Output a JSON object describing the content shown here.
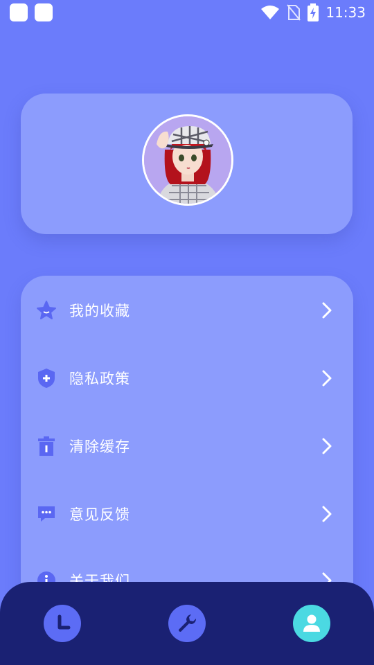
{
  "status_bar": {
    "time": "11:33",
    "icons": [
      "app-square-icon",
      "app-square-icon",
      "wifi-icon",
      "no-sim-icon",
      "battery-charging-icon"
    ]
  },
  "profile": {
    "avatar": "avatar-image"
  },
  "menu": {
    "items": [
      {
        "label": "我的收藏",
        "icon": "star-icon"
      },
      {
        "label": "隐私政策",
        "icon": "shield-icon"
      },
      {
        "label": "清除缓存",
        "icon": "trash-icon"
      },
      {
        "label": "意见反馈",
        "icon": "chat-bubble-icon"
      },
      {
        "label": "关于我们",
        "icon": "info-icon"
      }
    ]
  },
  "bottom_nav": {
    "tabs": [
      {
        "icon": "clock-icon",
        "active": false
      },
      {
        "icon": "wrench-icon",
        "active": false
      },
      {
        "icon": "user-icon",
        "active": true
      }
    ]
  },
  "colors": {
    "background": "#6b7cfb",
    "card": "#8c9cfd",
    "icon_accent": "#5a67f2",
    "nav_bg": "#1a2173",
    "nav_btn": "#5c6cf5",
    "nav_active": "#4bd9e2"
  }
}
